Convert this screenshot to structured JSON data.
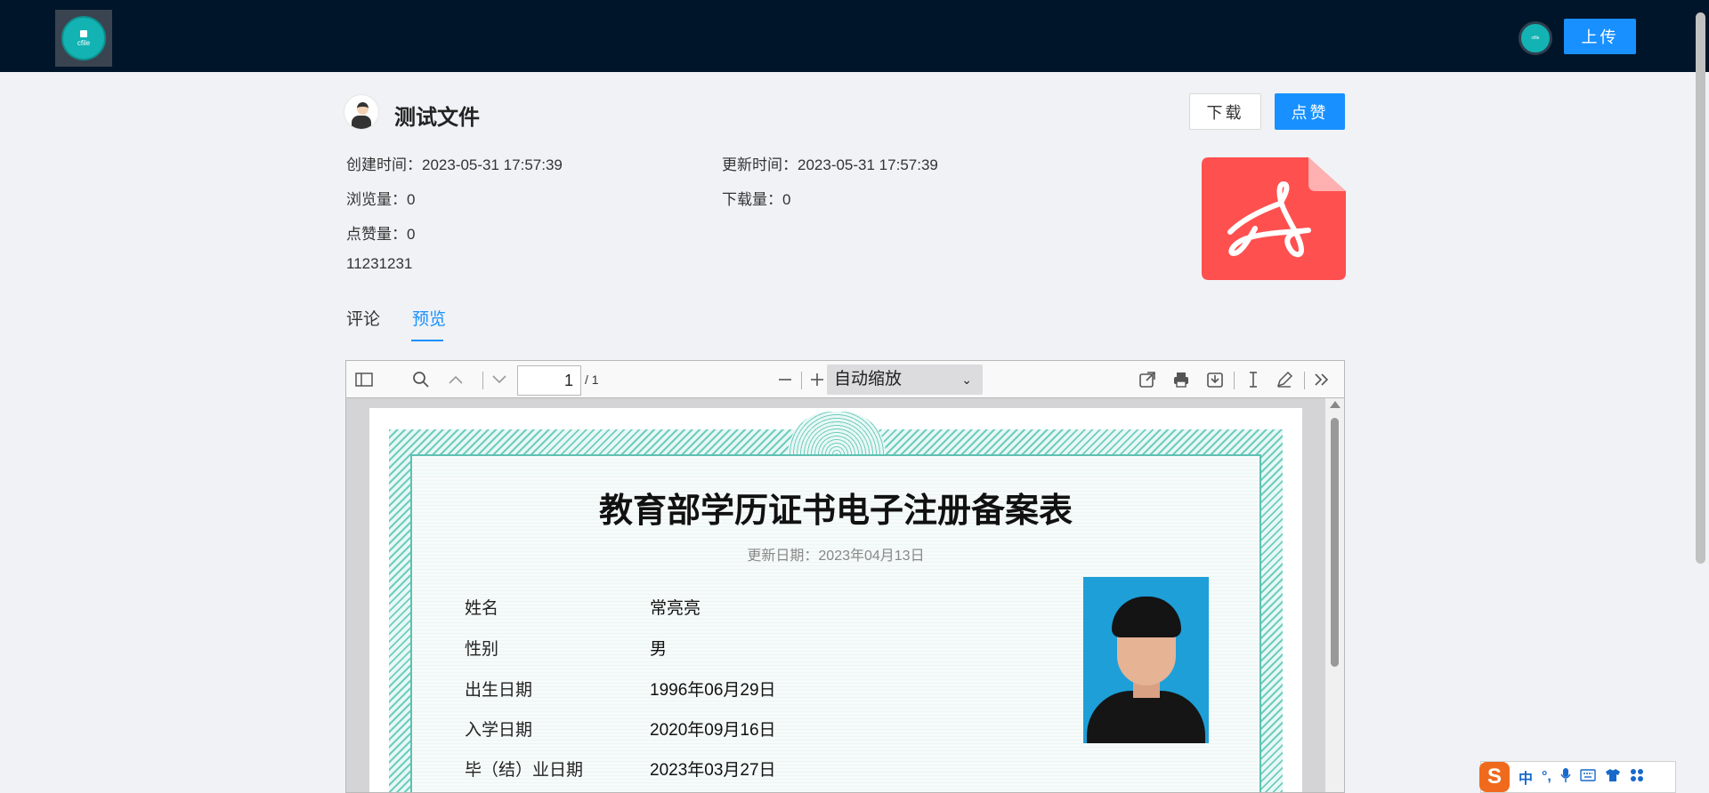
{
  "navbar": {
    "logo_text": "cfile",
    "avatar_text": "cfile",
    "upload_label": "上传"
  },
  "file": {
    "title": "测试文件",
    "download_label": "下载",
    "like_label": "点赞",
    "created": "创建时间：2023-05-31 17:57:39",
    "updated": "更新时间：2023-05-31 17:57:39",
    "views": "浏览量：0",
    "downloads": "下载量：0",
    "likes": "点赞量：0",
    "description": "11231231"
  },
  "tabs": [
    {
      "label": "评论",
      "active": false
    },
    {
      "label": "预览",
      "active": true
    }
  ],
  "viewer": {
    "page_number": "1",
    "page_total": "/ 1",
    "zoom": "自动缩放"
  },
  "certificate": {
    "title": "教育部学历证书电子注册备案表",
    "update_date": "更新日期：2023年04月13日",
    "fields": [
      {
        "label": "姓名",
        "value": "常亮亮"
      },
      {
        "label": "性别",
        "value": "男"
      },
      {
        "label": "出生日期",
        "value": "1996年06月29日"
      },
      {
        "label": "入学日期",
        "value": "2020年09月16日"
      },
      {
        "label": "毕（结）业日期",
        "value": "2023年03月27日"
      }
    ]
  },
  "ime": {
    "logo": "S",
    "mode": "中",
    "punct": "°,"
  },
  "colors": {
    "navbar": "#001529",
    "primary": "#1890ff",
    "pdf_icon": "#ff5050"
  }
}
